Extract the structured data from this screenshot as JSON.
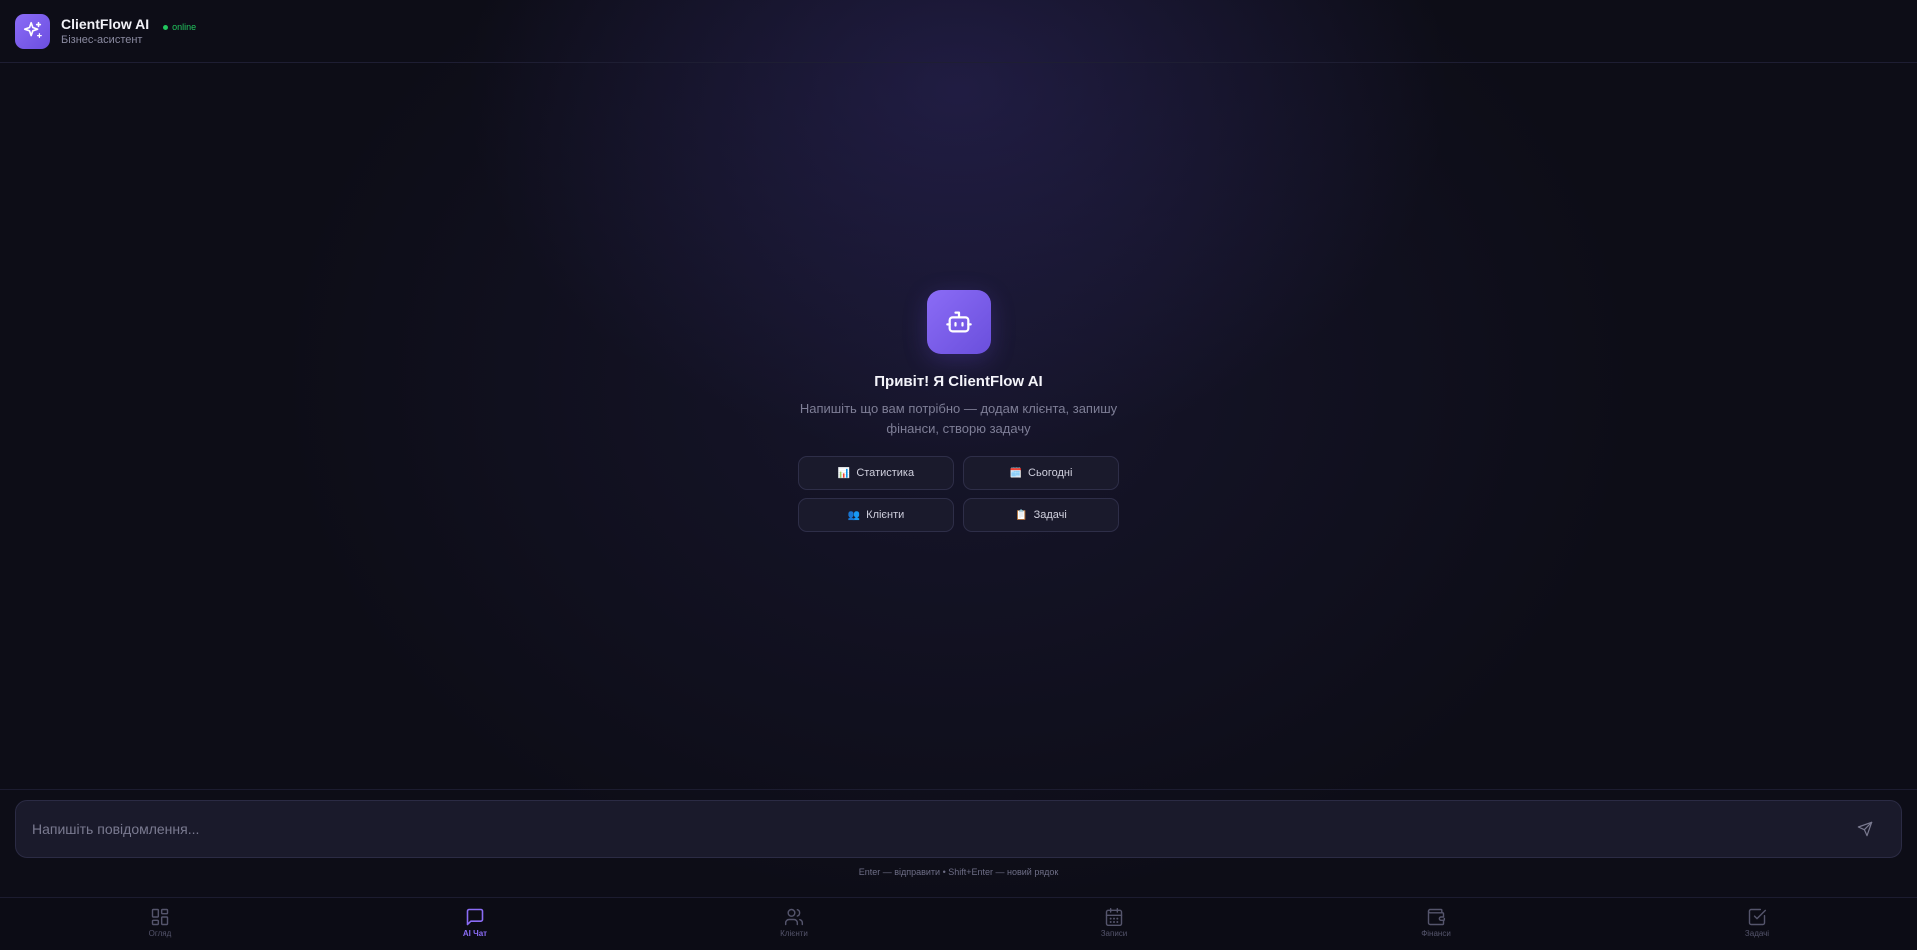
{
  "header": {
    "title": "ClientFlow AI",
    "status": "online",
    "subtitle": "Бізнес-асистент"
  },
  "welcome": {
    "title": "Привіт! Я ClientFlow AI",
    "description": "Напишіть що вам потрібно — додам клієнта, запишу фінанси, створю задачу"
  },
  "quick_actions": [
    {
      "icon": "bar-chart-emoji",
      "emoji": "📊",
      "label": "Статистика"
    },
    {
      "icon": "calendar-emoji",
      "emoji": "🗓️",
      "label": "Сьогодні"
    },
    {
      "icon": "people-emoji",
      "emoji": "👥",
      "label": "Клієнти"
    },
    {
      "icon": "clipboard-emoji",
      "emoji": "📋",
      "label": "Задачі"
    }
  ],
  "composer": {
    "placeholder": "Напишіть повідомлення...",
    "hint": "Enter — відправити • Shift+Enter — новий рядок"
  },
  "nav": {
    "items": [
      {
        "label": "Огляд",
        "icon": "grid-icon"
      },
      {
        "label": "AI Чат",
        "icon": "chat-icon",
        "active": true
      },
      {
        "label": "Клієнти",
        "icon": "users-icon"
      },
      {
        "label": "Записи",
        "icon": "calendar-icon"
      },
      {
        "label": "Фінанси",
        "icon": "wallet-icon"
      },
      {
        "label": "Задачі",
        "icon": "checkbox-icon"
      }
    ]
  },
  "colors": {
    "accent": "#8b6cf6",
    "online": "#22c55e",
    "background": "#0d0d17"
  }
}
